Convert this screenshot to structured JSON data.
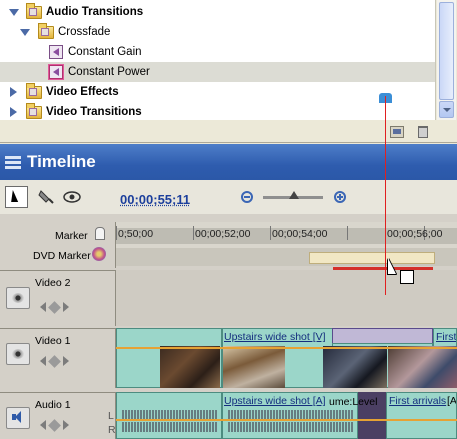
{
  "effects_panel": {
    "items": [
      {
        "label": "Audio Transitions",
        "bold": true
      },
      {
        "label": "Crossfade",
        "bold": false
      },
      {
        "label": "Constant Gain",
        "bold": false
      },
      {
        "label": "Constant Power",
        "bold": false,
        "selected": true
      },
      {
        "label": "Video Effects",
        "bold": true
      },
      {
        "label": "Video Transitions",
        "bold": true
      }
    ]
  },
  "timeline": {
    "title": "Timeline",
    "timecode": "00;00;55;11",
    "ruler_labels": [
      "0;50;00",
      "00;00;52;00",
      "00;00;54;00",
      "00;00;56;00"
    ],
    "marker_label": "Marker",
    "dvd_marker_label": "DVD Marker",
    "tracks": [
      {
        "name": "Video 2"
      },
      {
        "name": "Video 1"
      },
      {
        "name": "Audio 1"
      }
    ],
    "clips": {
      "video1_a": "Upstairs wide shot [V]",
      "video1_b": "First",
      "audio1_a": "Upstairs wide shot [A]",
      "audio1_vol": "ume:Level",
      "audio1_b": "First arrivals",
      "audio1_c": "[A]"
    },
    "lr": [
      "L",
      "R"
    ]
  },
  "colors": {
    "accent": "#2e5cae",
    "playhead": "#e02020",
    "clip": "#9bd6c9"
  }
}
